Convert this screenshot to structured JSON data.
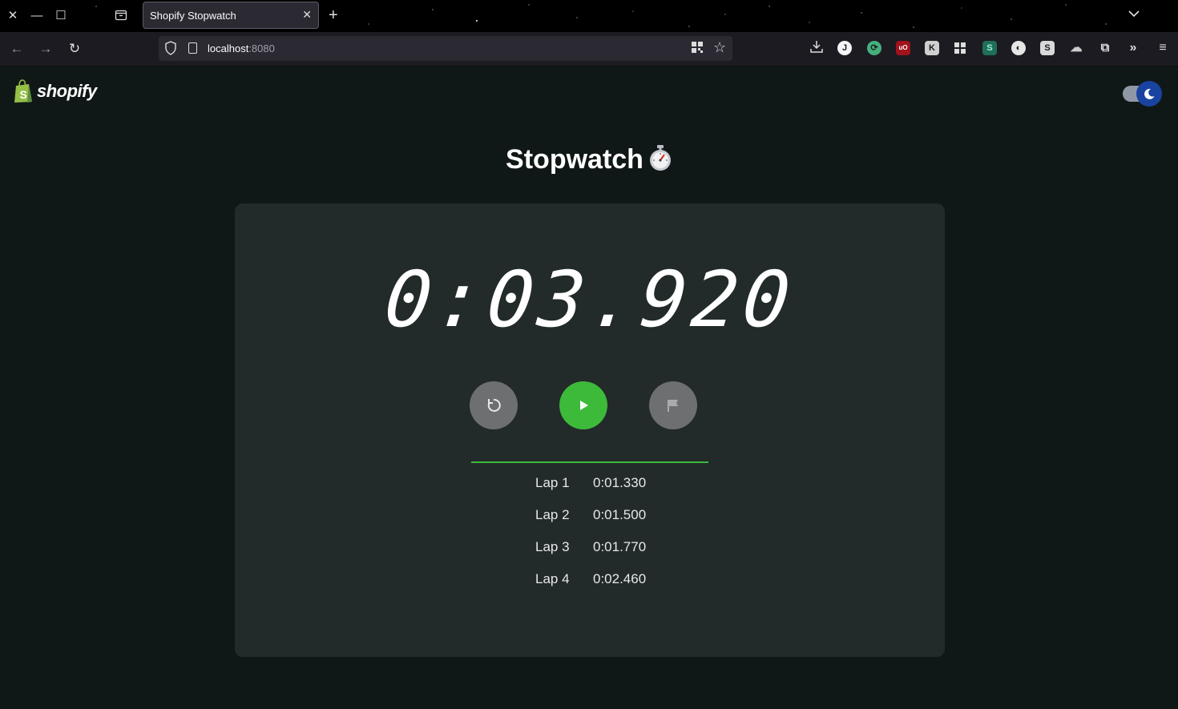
{
  "browser": {
    "tab_title": "Shopify Stopwatch",
    "url_host": "localhost",
    "url_port": ":8080"
  },
  "page": {
    "logo_text": "shopify",
    "title": "Stopwatch",
    "title_icon": "stopwatch-emoji",
    "theme_toggle": {
      "mode": "dark",
      "icon": "moon-icon"
    },
    "accent_color": "#3dba3a",
    "card_color": "#222a2a"
  },
  "stopwatch": {
    "display": "0:03.920",
    "controls": [
      {
        "name": "reset",
        "icon": "reset-icon"
      },
      {
        "name": "play",
        "icon": "play-icon"
      },
      {
        "name": "lap",
        "icon": "flag-icon"
      }
    ],
    "laps": [
      {
        "label": "Lap 1",
        "time": "0:01.330"
      },
      {
        "label": "Lap 2",
        "time": "0:01.500"
      },
      {
        "label": "Lap 3",
        "time": "0:01.770"
      },
      {
        "label": "Lap 4",
        "time": "0:02.460"
      }
    ]
  }
}
